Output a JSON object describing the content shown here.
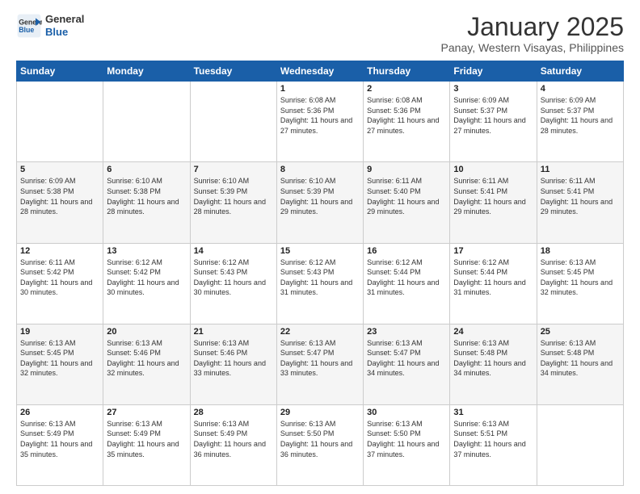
{
  "logo": {
    "line1": "General",
    "line2": "Blue"
  },
  "header": {
    "month": "January 2025",
    "location": "Panay, Western Visayas, Philippines"
  },
  "weekdays": [
    "Sunday",
    "Monday",
    "Tuesday",
    "Wednesday",
    "Thursday",
    "Friday",
    "Saturday"
  ],
  "weeks": [
    [
      {
        "day": "",
        "sunrise": "",
        "sunset": "",
        "daylight": ""
      },
      {
        "day": "",
        "sunrise": "",
        "sunset": "",
        "daylight": ""
      },
      {
        "day": "",
        "sunrise": "",
        "sunset": "",
        "daylight": ""
      },
      {
        "day": "1",
        "sunrise": "6:08 AM",
        "sunset": "5:36 PM",
        "daylight": "11 hours and 27 minutes."
      },
      {
        "day": "2",
        "sunrise": "6:08 AM",
        "sunset": "5:36 PM",
        "daylight": "11 hours and 27 minutes."
      },
      {
        "day": "3",
        "sunrise": "6:09 AM",
        "sunset": "5:37 PM",
        "daylight": "11 hours and 27 minutes."
      },
      {
        "day": "4",
        "sunrise": "6:09 AM",
        "sunset": "5:37 PM",
        "daylight": "11 hours and 28 minutes."
      }
    ],
    [
      {
        "day": "5",
        "sunrise": "6:09 AM",
        "sunset": "5:38 PM",
        "daylight": "11 hours and 28 minutes."
      },
      {
        "day": "6",
        "sunrise": "6:10 AM",
        "sunset": "5:38 PM",
        "daylight": "11 hours and 28 minutes."
      },
      {
        "day": "7",
        "sunrise": "6:10 AM",
        "sunset": "5:39 PM",
        "daylight": "11 hours and 28 minutes."
      },
      {
        "day": "8",
        "sunrise": "6:10 AM",
        "sunset": "5:39 PM",
        "daylight": "11 hours and 29 minutes."
      },
      {
        "day": "9",
        "sunrise": "6:11 AM",
        "sunset": "5:40 PM",
        "daylight": "11 hours and 29 minutes."
      },
      {
        "day": "10",
        "sunrise": "6:11 AM",
        "sunset": "5:41 PM",
        "daylight": "11 hours and 29 minutes."
      },
      {
        "day": "11",
        "sunrise": "6:11 AM",
        "sunset": "5:41 PM",
        "daylight": "11 hours and 29 minutes."
      }
    ],
    [
      {
        "day": "12",
        "sunrise": "6:11 AM",
        "sunset": "5:42 PM",
        "daylight": "11 hours and 30 minutes."
      },
      {
        "day": "13",
        "sunrise": "6:12 AM",
        "sunset": "5:42 PM",
        "daylight": "11 hours and 30 minutes."
      },
      {
        "day": "14",
        "sunrise": "6:12 AM",
        "sunset": "5:43 PM",
        "daylight": "11 hours and 30 minutes."
      },
      {
        "day": "15",
        "sunrise": "6:12 AM",
        "sunset": "5:43 PM",
        "daylight": "11 hours and 31 minutes."
      },
      {
        "day": "16",
        "sunrise": "6:12 AM",
        "sunset": "5:44 PM",
        "daylight": "11 hours and 31 minutes."
      },
      {
        "day": "17",
        "sunrise": "6:12 AM",
        "sunset": "5:44 PM",
        "daylight": "11 hours and 31 minutes."
      },
      {
        "day": "18",
        "sunrise": "6:13 AM",
        "sunset": "5:45 PM",
        "daylight": "11 hours and 32 minutes."
      }
    ],
    [
      {
        "day": "19",
        "sunrise": "6:13 AM",
        "sunset": "5:45 PM",
        "daylight": "11 hours and 32 minutes."
      },
      {
        "day": "20",
        "sunrise": "6:13 AM",
        "sunset": "5:46 PM",
        "daylight": "11 hours and 32 minutes."
      },
      {
        "day": "21",
        "sunrise": "6:13 AM",
        "sunset": "5:46 PM",
        "daylight": "11 hours and 33 minutes."
      },
      {
        "day": "22",
        "sunrise": "6:13 AM",
        "sunset": "5:47 PM",
        "daylight": "11 hours and 33 minutes."
      },
      {
        "day": "23",
        "sunrise": "6:13 AM",
        "sunset": "5:47 PM",
        "daylight": "11 hours and 34 minutes."
      },
      {
        "day": "24",
        "sunrise": "6:13 AM",
        "sunset": "5:48 PM",
        "daylight": "11 hours and 34 minutes."
      },
      {
        "day": "25",
        "sunrise": "6:13 AM",
        "sunset": "5:48 PM",
        "daylight": "11 hours and 34 minutes."
      }
    ],
    [
      {
        "day": "26",
        "sunrise": "6:13 AM",
        "sunset": "5:49 PM",
        "daylight": "11 hours and 35 minutes."
      },
      {
        "day": "27",
        "sunrise": "6:13 AM",
        "sunset": "5:49 PM",
        "daylight": "11 hours and 35 minutes."
      },
      {
        "day": "28",
        "sunrise": "6:13 AM",
        "sunset": "5:49 PM",
        "daylight": "11 hours and 36 minutes."
      },
      {
        "day": "29",
        "sunrise": "6:13 AM",
        "sunset": "5:50 PM",
        "daylight": "11 hours and 36 minutes."
      },
      {
        "day": "30",
        "sunrise": "6:13 AM",
        "sunset": "5:50 PM",
        "daylight": "11 hours and 37 minutes."
      },
      {
        "day": "31",
        "sunrise": "6:13 AM",
        "sunset": "5:51 PM",
        "daylight": "11 hours and 37 minutes."
      },
      {
        "day": "",
        "sunrise": "",
        "sunset": "",
        "daylight": ""
      }
    ]
  ],
  "labels": {
    "sunrise_prefix": "Sunrise: ",
    "sunset_prefix": "Sunset: ",
    "daylight_prefix": "Daylight: "
  }
}
